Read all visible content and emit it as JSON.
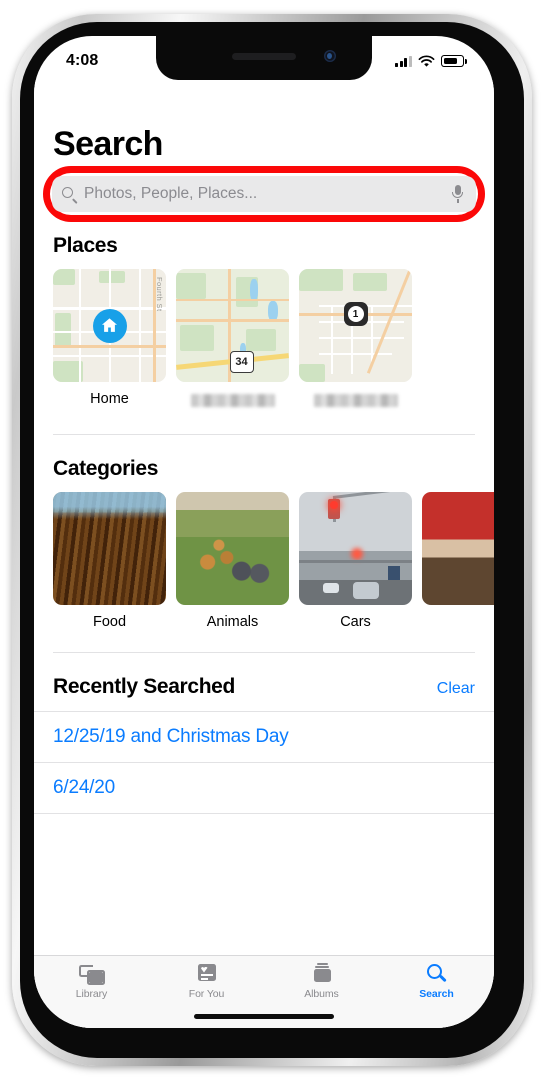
{
  "device": {
    "status_bar": {
      "time": "4:08",
      "cellular_icon": "signal-bars-icon",
      "wifi_icon": "wifi-icon",
      "battery_icon": "battery-icon"
    },
    "home_indicator": "home-indicator"
  },
  "app": {
    "page_title": "Search",
    "search": {
      "placeholder": "Photos, People, Places...",
      "value": "",
      "search_icon": "search-icon",
      "mic_icon": "microphone-icon",
      "highlight_color": "#fb0808"
    },
    "places": {
      "title": "Places",
      "items": [
        {
          "label": "Home",
          "redacted": false,
          "marker": "home-pin",
          "map_style": "map-a",
          "street_label": "Fourth St"
        },
        {
          "label": "",
          "redacted": true,
          "marker": "34",
          "map_style": "map-b",
          "street_label": ""
        },
        {
          "label": "",
          "redacted": true,
          "marker": "1",
          "map_style": "map-c",
          "street_label": ""
        }
      ]
    },
    "categories": {
      "title": "Categories",
      "items": [
        {
          "label": "Food",
          "photo_style": "ph-food"
        },
        {
          "label": "Animals",
          "photo_style": "ph-animals"
        },
        {
          "label": "Cars",
          "photo_style": "ph-cars"
        },
        {
          "label": "",
          "photo_style": "ph-partial"
        }
      ]
    },
    "recently_searched": {
      "title": "Recently Searched",
      "clear_label": "Clear",
      "items": [
        "12/25/19 and Christmas Day",
        "6/24/20"
      ]
    },
    "tab_bar": {
      "tabs": [
        {
          "label": "Library",
          "icon": "photo-stack-icon",
          "active": false
        },
        {
          "label": "For You",
          "icon": "memories-card-icon",
          "active": false
        },
        {
          "label": "Albums",
          "icon": "albums-icon",
          "active": false
        },
        {
          "label": "Search",
          "icon": "magnifier-icon",
          "active": true
        }
      ],
      "active_color": "#0a7cff",
      "inactive_color": "#8a8a8e"
    }
  }
}
